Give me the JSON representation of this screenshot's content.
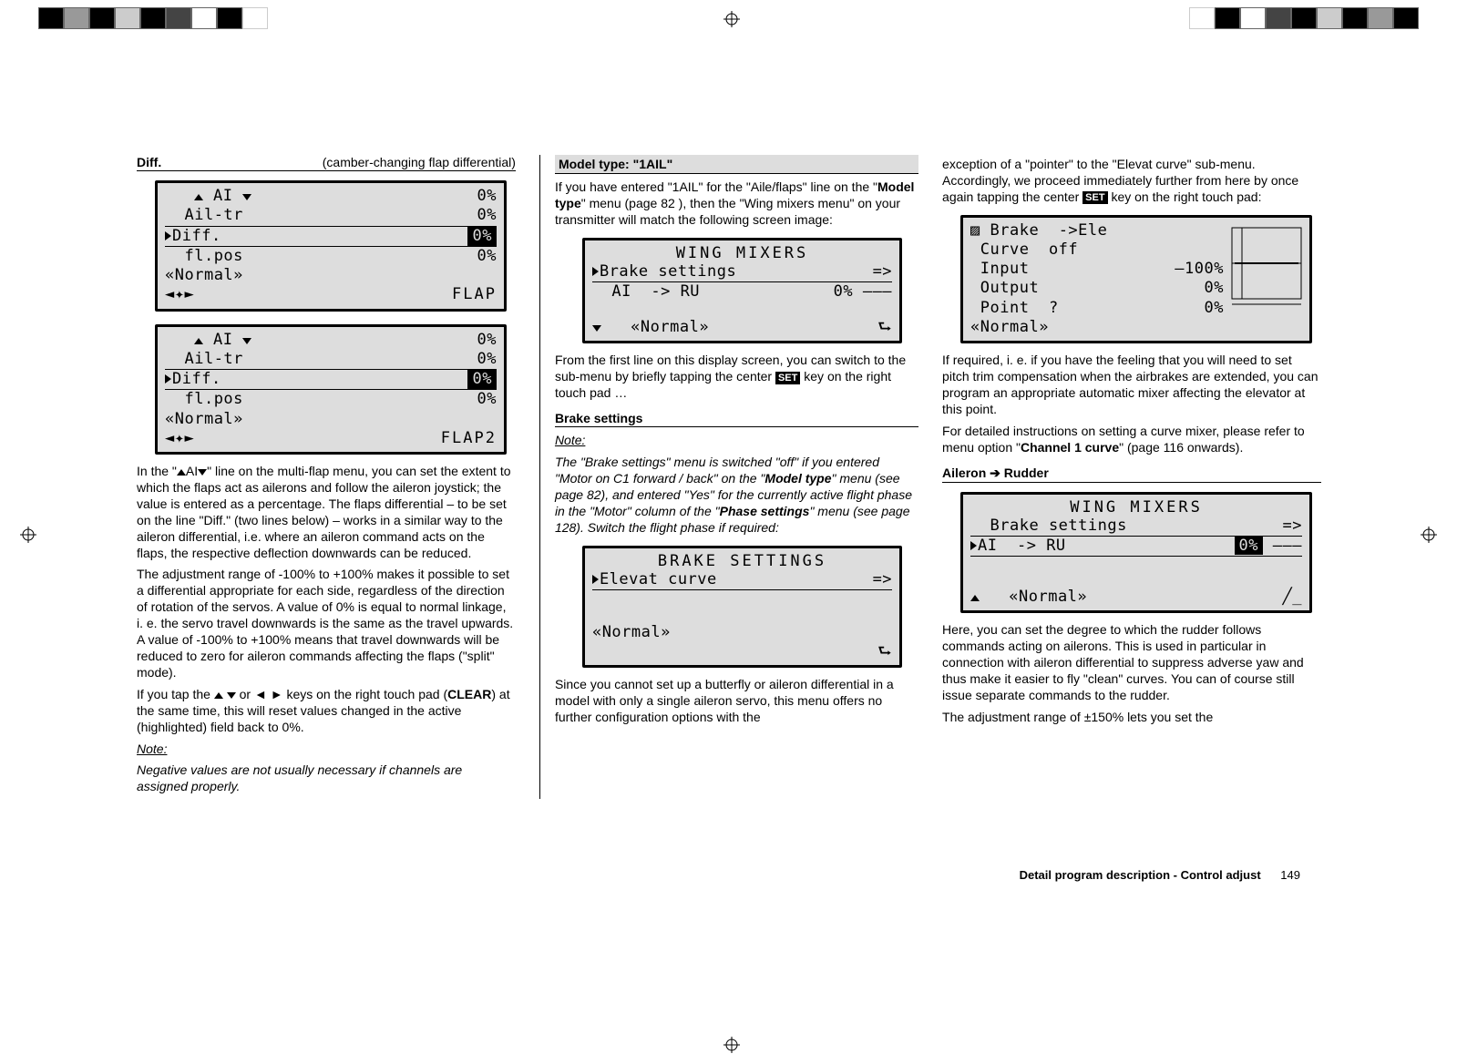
{
  "page": {
    "footer_text": "Detail program description - Control adjust",
    "page_number": "149"
  },
  "col1": {
    "header_left": "Diff.",
    "header_right": "(camber-changing flap differential)",
    "screen1": {
      "r1": "AI",
      "r1v": "0%",
      "r2": "Ail-tr",
      "r2v": "0%",
      "r3": "Diff.",
      "r3v": "0%",
      "r4": "fl.pos",
      "r4v": "0%",
      "r5": "Normal",
      "r6v": "FLAP"
    },
    "screen2": {
      "r1": "AI",
      "r1v": "0%",
      "r2": "Ail-tr",
      "r2v": "0%",
      "r3": "Diff.",
      "r3v": "0%",
      "r4": "fl.pos",
      "r4v": "0%",
      "r5": "Normal",
      "r6v": "FLAP2"
    },
    "p1a": "In the \"",
    "p1label": "AI",
    "p1b": "\" line on the multi-flap menu, you can set the extent to which the flaps act as ailerons and follow the aileron joystick; the value is entered as a percentage. The flaps differential – to be set on the line \"Diff.\" (two lines below) – works in a similar way to the aileron differential, i.e. where an aileron command acts on the flaps, the respective deflection downwards can be reduced.",
    "p2": "The adjustment range of -100% to +100% makes it possible to set a differential appropriate for each side, regardless of the direction of rotation of the servos. A value of 0% is equal to normal linkage, i. e. the servo travel downwards is the same as the travel upwards. A value of -100% to +100% means that travel downwards will be reduced to zero for aileron commands affecting the flaps (\"split\" mode).",
    "p3a": "If you tap the ",
    "p3b": " or ",
    "p3c": " keys on the right touch pad (",
    "p3clear": "CLEAR",
    "p3d": ") at the same time, this will reset values changed in the active (highlighted) field back to 0%.",
    "note_label": "Note:",
    "note_body": "Negative values are not usually necessary if channels are assigned properly."
  },
  "col2": {
    "title": "Model type: \"1AIL\"",
    "p1a": "If you have entered \"1AIL\" for the \"Aile/flaps\" line on the \"",
    "p1b": "Model type",
    "p1c": "\" menu (page 82 ), then the \"Wing mixers menu\" on your transmitter will match the following screen image:",
    "screen_wm": {
      "title": "WING  MIXERS",
      "r1": "Brake settings",
      "r1r": "=>",
      "r2l": "AI  -> RU",
      "r2r": "0% –––",
      "r3": "Normal"
    },
    "p2a": "From the first line on this display screen, you can switch to the sub-menu by briefly tapping the center ",
    "p2b": " key on the right touch pad …",
    "section2": "Brake settings",
    "note_label": "Note:",
    "note_body_a": "The \"Brake settings\" menu is switched \"off\" if you entered \"Motor on C1 forward / back\" on the \"",
    "note_body_b": "Model type",
    "note_body_c": "\" menu (see page 82), and entered \"Yes\" for the currently active flight phase in the \"Motor\" column of the \"",
    "note_body_d": "Phase settings",
    "note_body_e": "\" menu (see page 128). Switch the flight phase if required:",
    "screen_bs": {
      "title": "BRAKE  SETTINGS",
      "r1": "Elevat curve",
      "r1r": "=>",
      "r3": "Normal"
    },
    "p3": "Since you cannot set up a butterfly or aileron differential in a model with only a single aileron servo, this menu offers no further configuration options with the"
  },
  "col3": {
    "p1a": "exception of a \"pointer\" to the \"Elevat curve\" sub-menu. Accordingly, we proceed immediately further from here by once again tapping the center ",
    "p1b": " key on the right touch pad:",
    "screen_be": {
      "r1l": "Brake",
      "r1r": "Ele",
      "r2": "Curve  off",
      "r3l": "Input",
      "r3r": "–100%",
      "r4l": "Output",
      "r4r": "0%",
      "r5l": "Point  ?",
      "r5r": "0%",
      "r6": "Normal"
    },
    "p2": "If required, i. e. if you have the feeling that you will need to set pitch trim compensation when the airbrakes are extended, you can program an appropriate automatic mixer affecting the elevator at this point.",
    "p3a": "For detailed instructions on setting a curve mixer, please refer to menu option \"",
    "p3b": "Channel 1 curve",
    "p3c": "\" (page 116 onwards).",
    "section": "Aileron ➔ Rudder",
    "screen_wm2": {
      "title": "WING  MIXERS",
      "r1": "Brake settings",
      "r1r": "=>",
      "r2l": "AI  -> RU",
      "r2r": "0%",
      "r2r2": "–––",
      "r3": "Normal"
    },
    "p4": "Here, you can set the degree to which the rudder follows commands acting on ailerons. This is used in particular in connection with aileron differential to suppress adverse yaw and thus make it easier to fly \"clean\" curves. You can of course still issue separate commands to the rudder.",
    "p5": "The adjustment range of ±150% lets you set the"
  }
}
